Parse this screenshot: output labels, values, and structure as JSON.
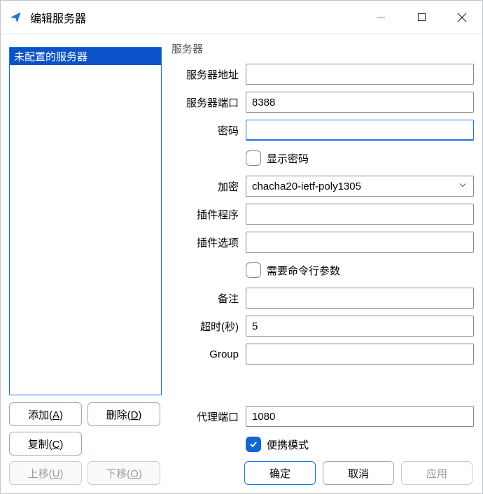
{
  "titlebar": {
    "title": "编辑服务器"
  },
  "sidebar": {
    "items": [
      {
        "label": "未配置的服务器",
        "selected": true
      }
    ],
    "buttons": {
      "add": "添加(A)",
      "delete": "删除(D)",
      "copy": "复制(C)",
      "moveup": "上移(U)",
      "movedown": "下移(O)"
    }
  },
  "form": {
    "group_label": "服务器",
    "server_addr_label": "服务器地址",
    "server_addr": "",
    "server_port_label": "服务器端口",
    "server_port": "8388",
    "password_label": "密码",
    "password": "",
    "show_password_label": "显示密码",
    "show_password_checked": false,
    "encryption_label": "加密",
    "encryption": "chacha20-ietf-poly1305",
    "plugin_prog_label": "插件程序",
    "plugin_prog": "",
    "plugin_opts_label": "插件选项",
    "plugin_opts": "",
    "cli_args_label": "需要命令行参数",
    "cli_args_checked": false,
    "remark_label": "备注",
    "remark": "",
    "timeout_label": "超时(秒)",
    "timeout": "5",
    "group_field_label": "Group",
    "group_field": "",
    "proxy_port_label": "代理端口",
    "proxy_port": "1080",
    "portable_label": "便携模式",
    "portable_checked": true
  },
  "footer": {
    "ok": "确定",
    "cancel": "取消",
    "apply": "应用"
  }
}
